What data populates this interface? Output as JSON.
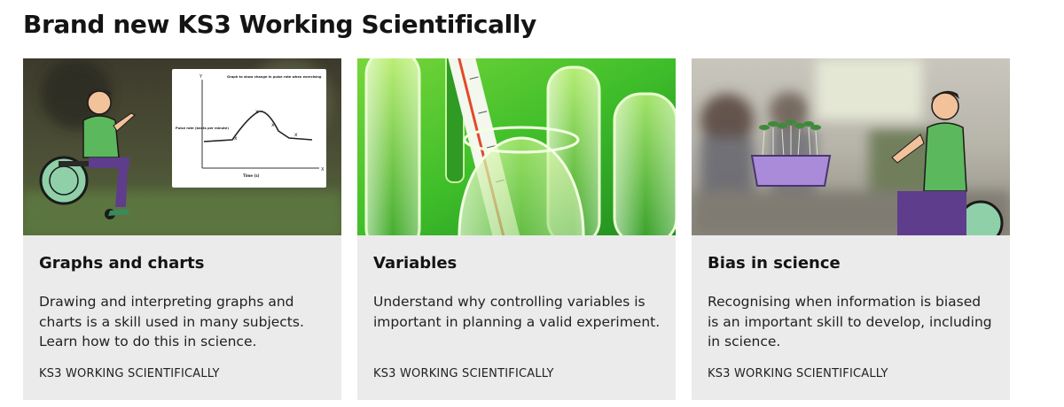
{
  "section": {
    "title": "Brand new KS3 Working Scientifically"
  },
  "cards": [
    {
      "title": "Graphs and charts",
      "description": "Drawing and interpreting graphs and charts is a skill used in many subjects. Learn how to do this in science.",
      "tag": "KS3 WORKING SCIENTIFICALLY",
      "thumbnail": {
        "graph_title": "Graph to show change in pulse rate when exercising",
        "y_label": "Pulse rate (beats per minute)",
        "x_label": "Time (s)",
        "y_axis_letter": "Y",
        "x_axis_letter": "X"
      }
    },
    {
      "title": "Variables",
      "description": "Understand why controlling variables is important in planning a valid experiment.",
      "tag": "KS3 WORKING SCIENTIFICALLY"
    },
    {
      "title": "Bias in science",
      "description": "Recognising when information is biased is an important skill to develop, including in science.",
      "tag": "KS3 WORKING SCIENTIFICALLY"
    }
  ],
  "colors": {
    "card_bg": "#ebebeb",
    "accent_green": "#4fb848"
  }
}
